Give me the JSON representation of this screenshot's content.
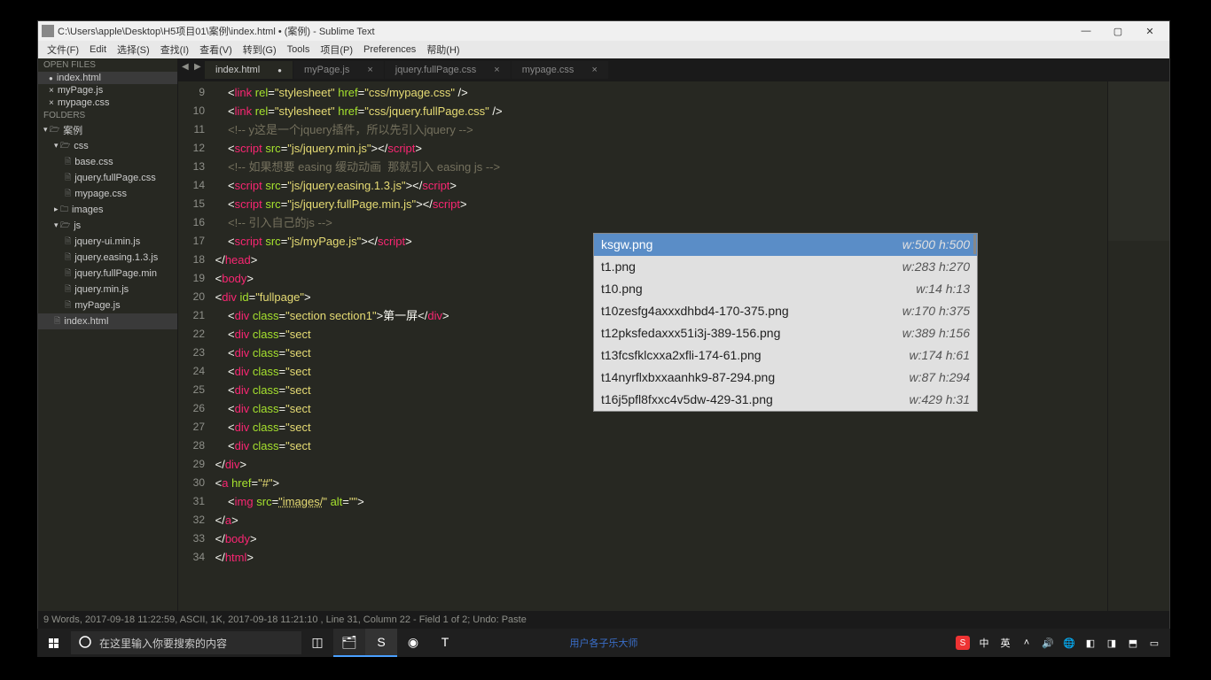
{
  "window": {
    "title": "C:\\Users\\apple\\Desktop\\H5项目01\\案例\\index.html • (案例) - Sublime Text"
  },
  "menu": {
    "items": [
      "文件(F)",
      "Edit",
      "选择(S)",
      "查找(I)",
      "查看(V)",
      "转到(G)",
      "Tools",
      "项目(P)",
      "Preferences",
      "帮助(H)"
    ]
  },
  "open_files": {
    "title": "OPEN FILES",
    "items": [
      {
        "name": "index.html",
        "dirty": true
      },
      {
        "name": "myPage.js",
        "dirty": false
      },
      {
        "name": "mypage.css",
        "dirty": false
      }
    ]
  },
  "folders": {
    "title": "FOLDERS",
    "root": "案例",
    "css_folder": "css",
    "css_files": [
      "base.css",
      "jquery.fullPage.css",
      "mypage.css"
    ],
    "images_folder": "images",
    "js_folder": "js",
    "js_files": [
      "jquery-ui.min.js",
      "jquery.easing.1.3.js",
      "jquery.fullPage.min",
      "jquery.min.js",
      "myPage.js"
    ],
    "root_file": "index.html"
  },
  "tabs": [
    {
      "label": "index.html",
      "dirty": true,
      "active": true
    },
    {
      "label": "myPage.js",
      "dirty": false,
      "active": false
    },
    {
      "label": "jquery.fullPage.css",
      "dirty": false,
      "active": false
    },
    {
      "label": "mypage.css",
      "dirty": false,
      "active": false
    }
  ],
  "gutter": {
    "start": 9,
    "end": 34,
    "current": 31
  },
  "autocomplete": [
    {
      "name": "ksgw.png",
      "dims": "w:500 h:500",
      "selected": true
    },
    {
      "name": "t1.png",
      "dims": "w:283 h:270"
    },
    {
      "name": "t10.png",
      "dims": "w:14 h:13"
    },
    {
      "name": "t10zesfg4axxxdhbd4-170-375.png",
      "dims": "w:170 h:375"
    },
    {
      "name": "t12pksfedaxxx51i3j-389-156.png",
      "dims": "w:389 h:156"
    },
    {
      "name": "t13fcsfklcxxa2xfli-174-61.png",
      "dims": "w:174 h:61"
    },
    {
      "name": "t14nyrflxbxxaanhk9-87-294.png",
      "dims": "w:87 h:294"
    },
    {
      "name": "t16j5pfl8fxxc4v5dw-429-31.png",
      "dims": "w:429 h:31"
    }
  ],
  "status": "9 Words, 2017-09-18 11:22:59, ASCII, 1K, 2017-09-18 11:21:10 , Line 31, Column 22 - Field 1 of 2; Undo: Paste",
  "taskbar": {
    "search_placeholder": "在这里输入你要搜索的内容",
    "center": "用户各子乐大师",
    "ime1": "中",
    "ime2": "英"
  }
}
